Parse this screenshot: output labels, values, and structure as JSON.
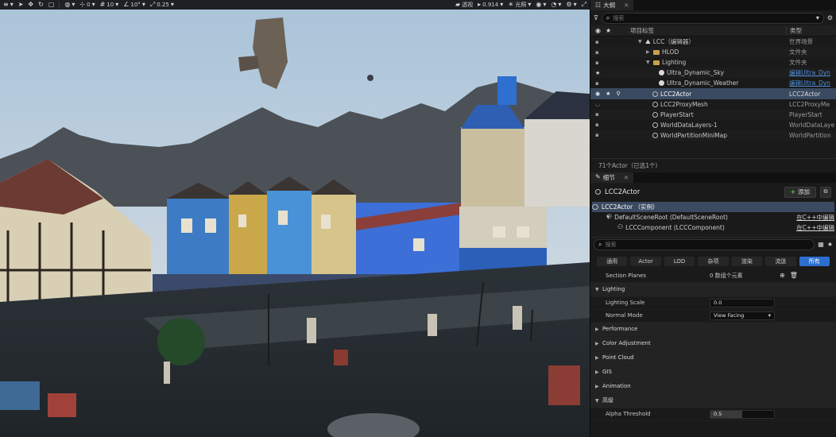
{
  "toolbar": {
    "values": [
      "0",
      "10",
      "10°",
      "0.25"
    ],
    "perspective": "透视",
    "camera_speed": "0.914",
    "lit_mode": "光照"
  },
  "outliner": {
    "tab_label": "大纲",
    "search_placeholder": "搜索",
    "col_label": "项目标签",
    "col_type": "类型",
    "rows": [
      {
        "label": "LCC（编辑器）",
        "type": "世界场景",
        "indent": 1
      },
      {
        "label": "HLOD",
        "type": "文件夹",
        "indent": 2
      },
      {
        "label": "Lighting",
        "type": "文件夹",
        "indent": 2
      },
      {
        "label": "Ultra_Dynamic_Sky",
        "type": "编辑Ultra_Dyn",
        "indent": 3
      },
      {
        "label": "Ultra_Dynamic_Weather",
        "type": "编辑Ultra_Dyn",
        "indent": 3
      },
      {
        "label": "LCC2Actor",
        "type": "LCC2Actor",
        "indent": 2
      },
      {
        "label": "LCC2ProxyMesh",
        "type": "LCC2ProxyMe",
        "indent": 2
      },
      {
        "label": "PlayerStart",
        "type": "PlayerStart",
        "indent": 2
      },
      {
        "label": "WorldDataLayers-1",
        "type": "WorldDataLaye",
        "indent": 2
      },
      {
        "label": "WorldPartitionMiniMap",
        "type": "WorldPartition",
        "indent": 2
      }
    ],
    "status": "71个Actor（已选1个）"
  },
  "details": {
    "tab_label": "细节",
    "actor_name": "LCC2Actor",
    "add_label": "添加",
    "components": [
      {
        "label": "LCC2Actor （实例）",
        "right": ""
      },
      {
        "label": "DefaultSceneRoot (DefaultSceneRoot)",
        "right": "在C++中编辑"
      },
      {
        "label": "LCCComponent (LCCComponent)",
        "right": "在C++中编辑"
      }
    ],
    "search_placeholder": "搜索",
    "filters": [
      "通用",
      "Actor",
      "LOD",
      "杂项",
      "渲染",
      "流送",
      "所有"
    ],
    "section_planes_label": "Section Planes",
    "section_planes_value": "0 数组个元素",
    "lighting_cat": "Lighting",
    "lighting_scale_label": "Lighting Scale",
    "lighting_scale_value": "0.0",
    "normal_mode_label": "Normal Mode",
    "normal_mode_value": "View Facing",
    "categories": [
      "Performance",
      "Color Adjustment",
      "Point Cloud",
      "GIS",
      "Animation"
    ],
    "advanced_cat": "高级",
    "alpha_threshold_label": "Alpha Threshold",
    "alpha_threshold_value": "0.5",
    "alpha_threshold_fraction": 0.5
  }
}
